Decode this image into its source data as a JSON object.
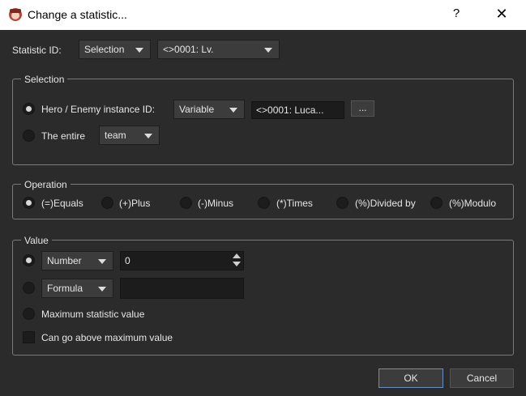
{
  "window": {
    "title": "Change a statistic...",
    "help": "?",
    "close": "✕"
  },
  "statistic": {
    "label": "Statistic ID:",
    "mode": "Selection",
    "value": "<>0001: Lv."
  },
  "selection": {
    "title": "Selection",
    "instance_label": "Hero / Enemy instance ID:",
    "instance_mode": "Variable",
    "instance_value": "<>0001: Luca...",
    "instance_browse": "...",
    "entire_label": "The entire",
    "entire_value": "team"
  },
  "operation": {
    "title": "Operation",
    "options": [
      "(=)Equals",
      "(+)Plus",
      "(-)Minus",
      "(*)Times",
      "(%)Divided by",
      "(%)Modulo"
    ]
  },
  "value": {
    "title": "Value",
    "number_mode": "Number",
    "number_value": "0",
    "formula_mode": "Formula",
    "formula_value": "",
    "max_label": "Maximum statistic value",
    "above_label": "Can go above maximum value"
  },
  "buttons": {
    "ok": "OK",
    "cancel": "Cancel"
  },
  "colors": {
    "background": "#2b2b2b",
    "titlebar": "#ffffff",
    "ok_border": "#6a8fbf"
  }
}
